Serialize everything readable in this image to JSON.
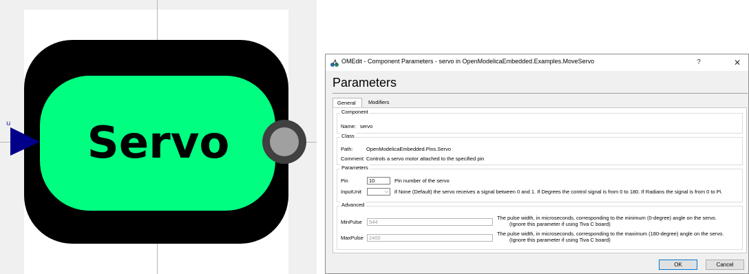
{
  "diagram": {
    "connector_label": "u",
    "icon_text": "Servo",
    "colors": {
      "body_outer": "#000000",
      "body_inner": "#00ff80",
      "input_connector": "#00008b",
      "output_ring": "#404040",
      "output_fill": "#a0a0a0"
    }
  },
  "dialog": {
    "title": "OMEdit - Component Parameters - servo in OpenModelicaEmbedded.Examples.MoveServo",
    "help_label": "?",
    "close_label": "✕",
    "heading": "Parameters",
    "tabs": [
      {
        "label": "General",
        "active": true
      },
      {
        "label": "Modifiers",
        "active": false
      }
    ],
    "component": {
      "title": "Component",
      "name_label": "Name:",
      "name_value": "servo"
    },
    "class": {
      "title": "Class",
      "path_label": "Path:",
      "path_value": "OpenModelicaEmbedded.Pins.Servo",
      "comment_label": "Comment:",
      "comment_value": "Controls a servo motor attached to the specified pin"
    },
    "parameters": {
      "title": "Parameters",
      "pin_label": "Pin",
      "pin_value": "10",
      "pin_desc": "Pin number of the servo",
      "inputunit_label": "InputUnit",
      "inputunit_value": "",
      "inputunit_desc": "if None (Default) the servo receives a signal between 0 and 1. If Degrees the control signal is from 0 to 180. If Radians the signal is from 0 to Pi."
    },
    "advanced": {
      "title": "Advanced",
      "minpulse_label": "MinPulse",
      "minpulse_placeholder": "544",
      "minpulse_desc_1": "The pulse width, in microseconds, corresponding to the minimum (0-degree) angle on the servo.",
      "minpulse_desc_2": "(Ignore this parameter if using Tiva C board)",
      "maxpulse_label": "MaxPulse",
      "maxpulse_placeholder": "2400",
      "maxpulse_desc_1": "The pulse width, in microseconds, corresponding to the maximum (180-degree) angle on the servo.",
      "maxpulse_desc_2": "(Ignore this parameter if using Tiva C board)"
    },
    "ok_label": "OK",
    "cancel_label": "Cancel"
  }
}
